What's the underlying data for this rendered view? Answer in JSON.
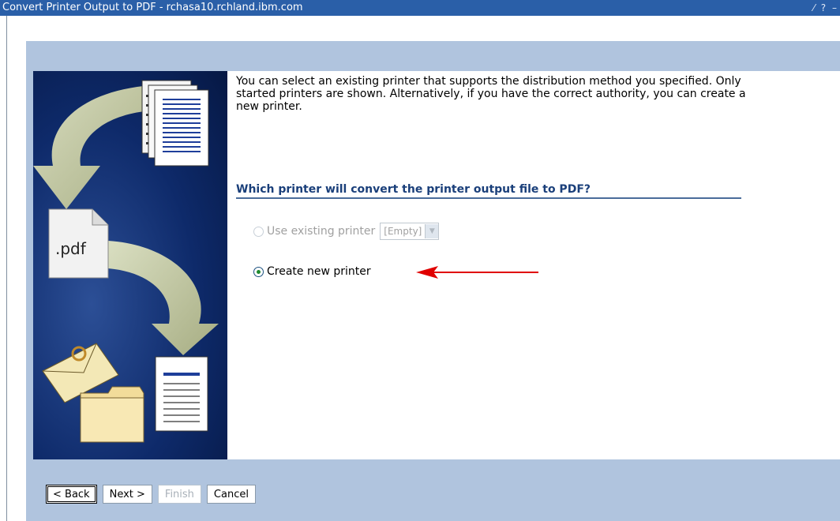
{
  "window": {
    "title": "Convert Printer Output to PDF - rchasa10.rchland.ibm.com",
    "controls": "⁄ ? –"
  },
  "art": {
    "doc_label": ".pdf"
  },
  "content": {
    "intro": "You can select an existing printer that supports the distribution method you specified. Only started printers are shown. Alternatively, if you have the correct authority, you can create a new printer.",
    "question": "Which printer will convert the printer output file to PDF?",
    "options": {
      "existing": {
        "label": "Use existing printer",
        "selected": false,
        "enabled": false
      },
      "existing_select": {
        "value": "[Empty]",
        "enabled": false
      },
      "create": {
        "label": "Create new printer",
        "selected": true,
        "enabled": true
      }
    }
  },
  "annotation": {
    "arrow_color": "#e00000"
  },
  "buttons": {
    "back": "< Back",
    "next": "Next >",
    "finish": "Finish",
    "cancel": "Cancel"
  },
  "colors": {
    "title_bar": "#2a5fa8",
    "wizard_bg": "#b0c4de",
    "heading": "#1a3f7a"
  }
}
